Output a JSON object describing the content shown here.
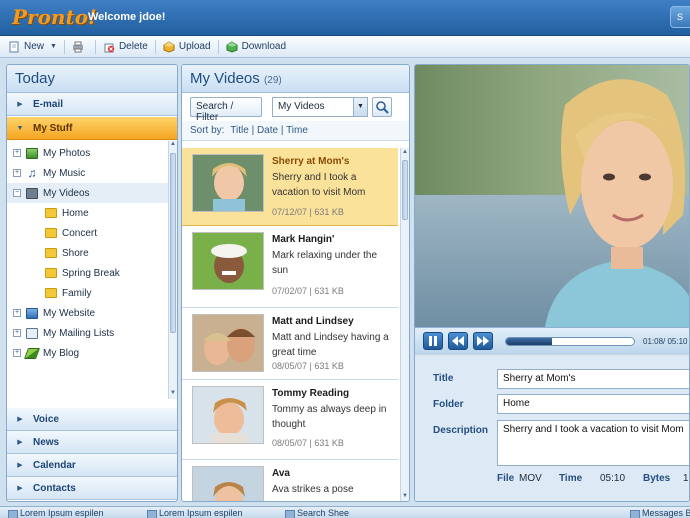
{
  "app": {
    "logo": "Pronto!",
    "welcome": "Welcome jdoe!",
    "top_button": "S"
  },
  "toolbar": {
    "new": "New",
    "delete": "Delete",
    "upload": "Upload",
    "download": "Download"
  },
  "today": {
    "title": "Today",
    "top_items": [
      {
        "label": "E-mail"
      },
      {
        "label": "My Stuff"
      }
    ],
    "tree": [
      {
        "label": "My Photos"
      },
      {
        "label": "My Music"
      },
      {
        "label": "My Videos"
      },
      {
        "label": "Home"
      },
      {
        "label": "Concert"
      },
      {
        "label": "Shore"
      },
      {
        "label": "Spring Break"
      },
      {
        "label": "Family"
      },
      {
        "label": "My Website"
      },
      {
        "label": "My Mailing Lists"
      },
      {
        "label": "My Blog"
      }
    ],
    "bottom_items": [
      {
        "label": "Voice"
      },
      {
        "label": "News"
      },
      {
        "label": "Calendar"
      },
      {
        "label": "Contacts"
      }
    ]
  },
  "videos": {
    "title": "My Videos",
    "count": "(29)",
    "filter_label": "Search / Filter",
    "select_value": "My Videos",
    "sort_label": "Sort by:",
    "sort_options": [
      "Title",
      "Date",
      "Time"
    ],
    "items": [
      {
        "title": "Sherry at Mom's",
        "desc": "Sherry and I took a vacation to visit Mom",
        "meta": "07/12/07 | 631 KB"
      },
      {
        "title": "Mark Hangin'",
        "desc": "Mark relaxing under the sun",
        "meta": "07/02/07 | 631 KB"
      },
      {
        "title": "Matt and Lindsey",
        "desc": "Matt and Lindsey having a great time",
        "meta": "08/05/07 | 631 KB"
      },
      {
        "title": "Tommy Reading",
        "desc": "Tommy as always deep in thought",
        "meta": "08/05/07 | 631 KB"
      },
      {
        "title": "Ava",
        "desc": "Ava strikes a pose",
        "meta": ""
      }
    ]
  },
  "player": {
    "time": "01:08/ 05:10",
    "progress": 0.36,
    "title_label": "Title",
    "title_value": "Sherry at Mom's",
    "folder_label": "Folder",
    "folder_value": "Home",
    "description_label": "Description",
    "description_value": "Sherry and I took a vacation to visit Mom",
    "file_label": "File",
    "file_value": "MOV",
    "time_label": "Time",
    "time_value": "05:10",
    "bytes_label": "Bytes",
    "bytes_value": "1"
  },
  "taskbar": [
    {
      "label": "Lorem Ipsum espilen"
    },
    {
      "label": "Lorem Ipsum espilen"
    },
    {
      "label": "Search Shee"
    },
    {
      "label": "Messages Bu"
    }
  ]
}
